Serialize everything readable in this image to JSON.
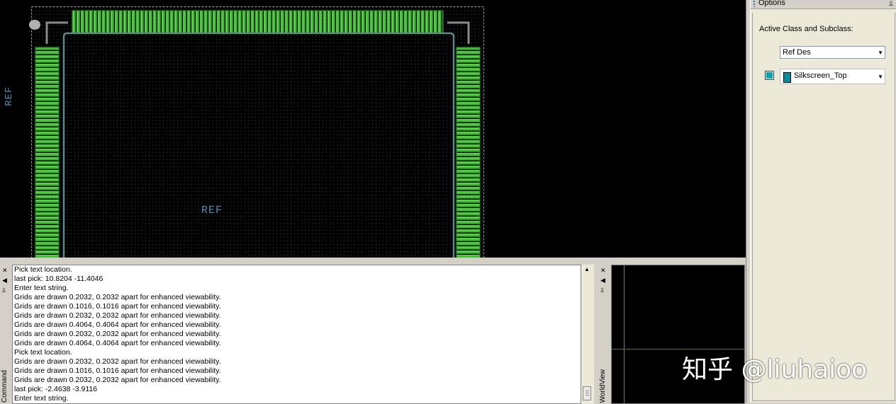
{
  "canvas": {
    "ref_label_vertical": "REF",
    "ref_label_center": "REF",
    "colors": {
      "background": "#000000",
      "pad_green": "#3bbf2f",
      "outline": "#5a8a8a",
      "text_ref": "#4d8fb5",
      "dot_grid": "#2a2a2a"
    }
  },
  "options_panel": {
    "title": "Options",
    "pin_icon": "pin-icon",
    "active_label": "Active Class and Subclass:",
    "class_value": "Ref Des",
    "subclass_value": "Silkscreen_Top",
    "subclass_color": "#008b9e"
  },
  "command_panel": {
    "tab_label": "Command",
    "lines": [
      "Pick text location.",
      "last pick:  10.8204 -11.4046",
      "Enter text string.",
      "Grids are drawn 0.2032, 0.2032 apart for enhanced viewability.",
      "Grids are drawn 0.1016, 0.1016 apart for enhanced viewability.",
      "Grids are drawn 0.2032, 0.2032 apart for enhanced viewability.",
      "Grids are drawn 0.4064, 0.4064 apart for enhanced viewability.",
      "Grids are drawn 0.2032, 0.2032 apart for enhanced viewability.",
      "Grids are drawn 0.4064, 0.4064 apart for enhanced viewability.",
      "Pick text location.",
      "Grids are drawn 0.2032, 0.2032 apart for enhanced viewability.",
      "Grids are drawn 0.1016, 0.1016 apart for enhanced viewability.",
      "Grids are drawn 0.2032, 0.2032 apart for enhanced viewability.",
      "last pick:  -2.4638 -3.9116",
      "Enter text string."
    ]
  },
  "worldview_panel": {
    "tab_label": "WorldView"
  },
  "watermark": "知乎 @liuhaioo"
}
